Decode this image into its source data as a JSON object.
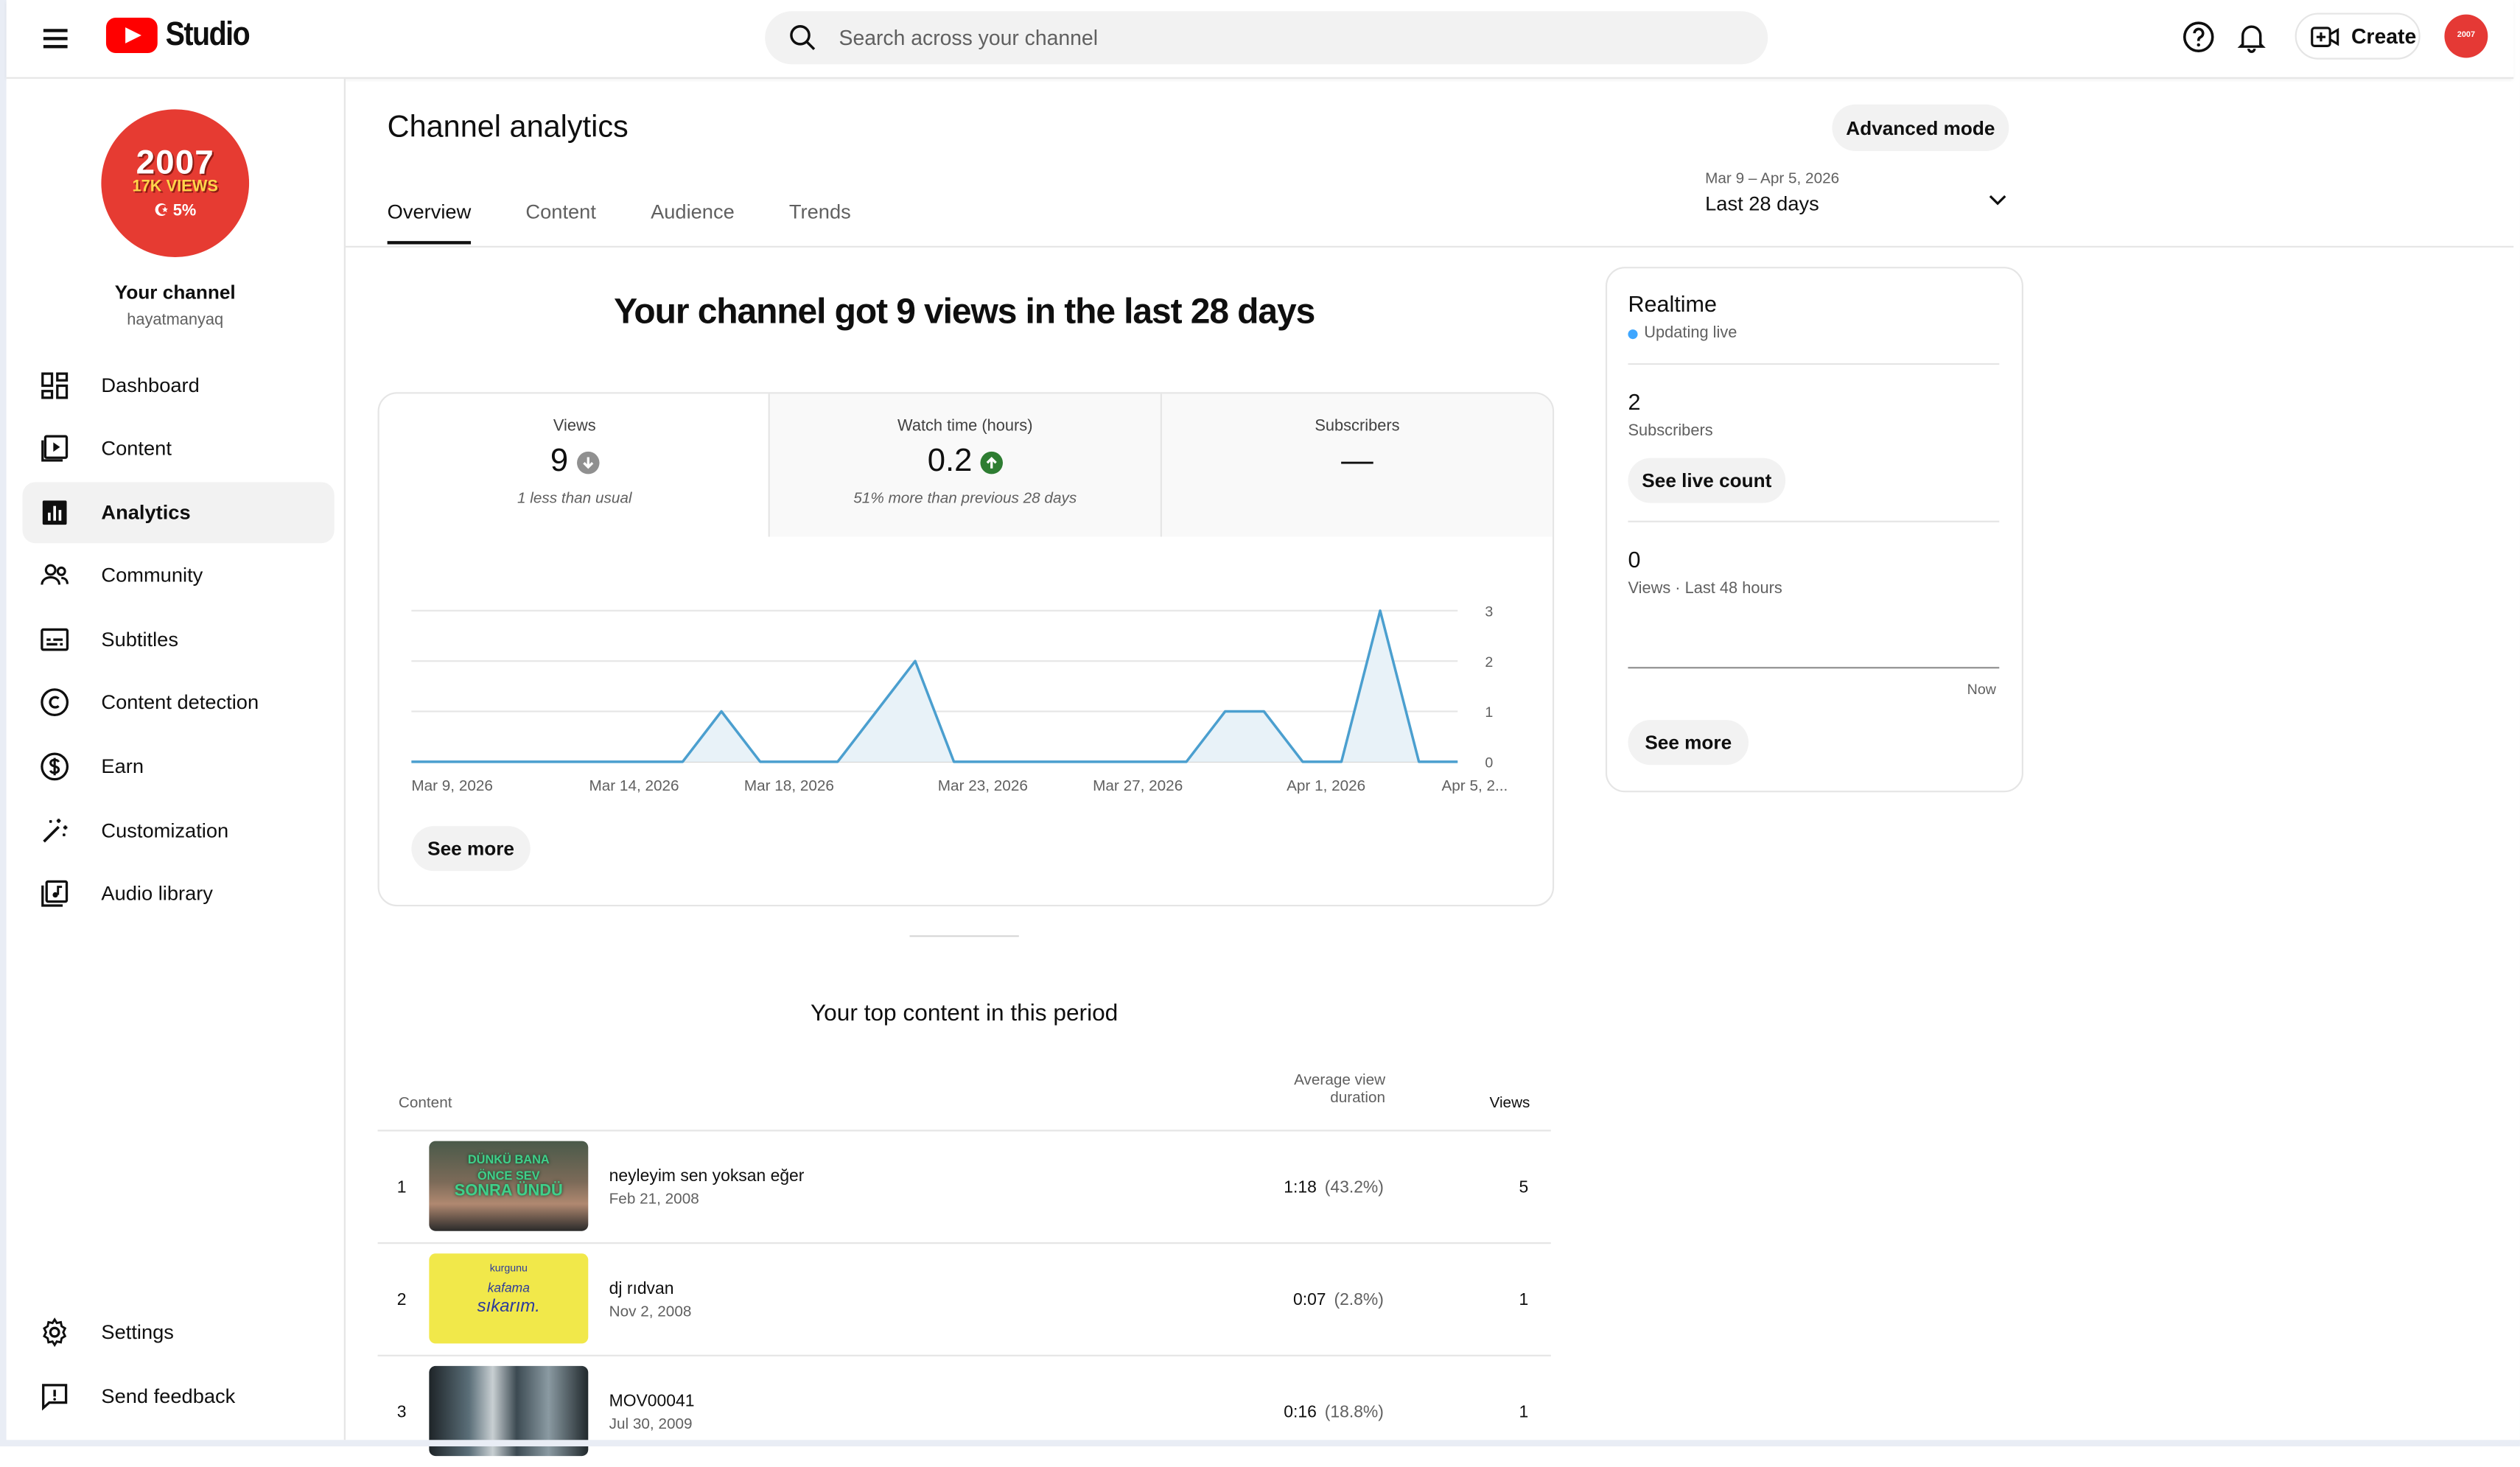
{
  "header": {
    "logo_text": "Studio",
    "search_placeholder": "Search across your channel",
    "create_label": "Create",
    "avatar_text": "2007"
  },
  "sidebar": {
    "channel_avatar_lines": [
      "2007",
      "17K VIEWS",
      "5%"
    ],
    "channel_title": "Your channel",
    "channel_handle": "hayatmanyaq",
    "items": [
      {
        "label": "Dashboard",
        "icon": "dashboard-icon"
      },
      {
        "label": "Content",
        "icon": "content-icon"
      },
      {
        "label": "Analytics",
        "icon": "analytics-icon",
        "active": true
      },
      {
        "label": "Community",
        "icon": "community-icon"
      },
      {
        "label": "Subtitles",
        "icon": "subtitles-icon"
      },
      {
        "label": "Content detection",
        "icon": "copyright-icon"
      },
      {
        "label": "Earn",
        "icon": "dollar-icon"
      },
      {
        "label": "Customization",
        "icon": "magic-wand-icon"
      },
      {
        "label": "Audio library",
        "icon": "audio-library-icon"
      }
    ],
    "bottom_items": [
      {
        "label": "Settings",
        "icon": "gear-icon"
      },
      {
        "label": "Send feedback",
        "icon": "feedback-icon"
      }
    ]
  },
  "main": {
    "title": "Channel analytics",
    "advanced_mode_label": "Advanced mode",
    "tabs": [
      {
        "label": "Overview",
        "active": true
      },
      {
        "label": "Content"
      },
      {
        "label": "Audience"
      },
      {
        "label": "Trends"
      }
    ],
    "date_range": {
      "dates": "Mar 9 – Apr 5, 2026",
      "label": "Last 28 days"
    },
    "headline": "Your channel got 9 views in the last 28 days",
    "metrics": [
      {
        "title": "Views",
        "value": "9",
        "trend": "down",
        "sub": "1 less than usual"
      },
      {
        "title": "Watch time (hours)",
        "value": "0.2",
        "trend": "up",
        "sub": "51% more than previous 28 days"
      },
      {
        "title": "Subscribers",
        "value": "—",
        "sub": ""
      }
    ],
    "see_more_label": "See more",
    "top_content": {
      "title": "Your top content in this period",
      "col_content": "Content",
      "col_avd_line1": "Average view",
      "col_avd_line2": "duration",
      "col_views": "Views",
      "rows": [
        {
          "rank": "1",
          "title": "neyleyim sen yoksan eğer",
          "date": "Feb 21, 2008",
          "avd": "1:18",
          "pct": "(43.2%)",
          "views": "5",
          "thumb_text": [
            "DÜNKÜ BANA",
            "ÖNCE SEV",
            "SONRA ÜNDÜ"
          ]
        },
        {
          "rank": "2",
          "title": "dj rıdvan",
          "date": "Nov 2, 2008",
          "avd": "0:07",
          "pct": "(2.8%)",
          "views": "1",
          "thumb_text": [
            "kurgunu",
            "kafama",
            "sıkarım."
          ]
        },
        {
          "rank": "3",
          "title": "MOV00041",
          "date": "Jul 30, 2009",
          "avd": "0:16",
          "pct": "(18.8%)",
          "views": "1"
        }
      ]
    }
  },
  "realtime": {
    "title": "Realtime",
    "status": "Updating live",
    "subscribers_value": "2",
    "subscribers_label": "Subscribers",
    "see_live_count_label": "See live count",
    "views_value": "0",
    "views_label": "Views · Last 48 hours",
    "now_label": "Now",
    "see_more_label": "See more"
  },
  "chart_data": {
    "type": "area",
    "x": [
      "Mar 9",
      "Mar 10",
      "Mar 11",
      "Mar 12",
      "Mar 13",
      "Mar 14",
      "Mar 15",
      "Mar 16",
      "Mar 17",
      "Mar 18",
      "Mar 19",
      "Mar 20",
      "Mar 21",
      "Mar 22",
      "Mar 23",
      "Mar 24",
      "Mar 25",
      "Mar 26",
      "Mar 27",
      "Mar 28",
      "Mar 29",
      "Mar 30",
      "Mar 31",
      "Apr 1",
      "Apr 2",
      "Apr 3",
      "Apr 4",
      "Apr 5"
    ],
    "series": [
      {
        "values": [
          0,
          0,
          0,
          0,
          0,
          0,
          0,
          0,
          1,
          0,
          0,
          0,
          1,
          2,
          0,
          0,
          0,
          0,
          0,
          0,
          0,
          1,
          1,
          0,
          0,
          3,
          0,
          0
        ]
      }
    ],
    "x_tick_labels": [
      "Mar 9, 2026",
      "Mar 14, 2026",
      "Mar 18, 2026",
      "Mar 23, 2026",
      "Mar 27, 2026",
      "Apr 1, 2026",
      "Apr 5, 2..."
    ],
    "x_tick_index": [
      0,
      5,
      9,
      14,
      18,
      23,
      27
    ],
    "y_ticks": [
      "0",
      "1",
      "2",
      "3"
    ],
    "ylim": [
      0,
      3
    ],
    "grid": true,
    "color": "#4b9fcf",
    "fill": "#e8f2f8"
  }
}
